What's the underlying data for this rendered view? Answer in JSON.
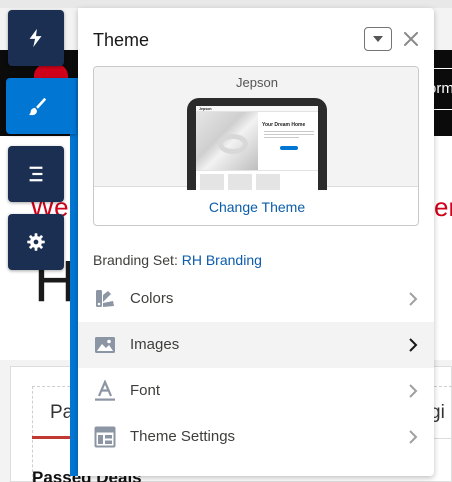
{
  "background": {
    "band_text": "orm",
    "red_left": "We",
    "red_right": "er",
    "big_letter": "H",
    "tab_left": "Pa",
    "tab_right": "gi",
    "bottom_heading": "Passed Deals"
  },
  "rail": {
    "items": [
      {
        "icon": "lightning-icon"
      },
      {
        "icon": "brush-icon",
        "active": true
      },
      {
        "icon": "list-icon"
      },
      {
        "icon": "gear-icon"
      }
    ]
  },
  "panel": {
    "title": "Theme",
    "theme_name": "Jepson",
    "preview": {
      "logo": "Jepson",
      "headline": "Your Dream Home"
    },
    "change_theme_label": "Change Theme",
    "branding_label": "Branding Set:",
    "branding_value": "RH Branding",
    "menu": [
      {
        "label": "Colors",
        "icon": "colors-icon"
      },
      {
        "label": "Images",
        "icon": "image-icon",
        "selected": true
      },
      {
        "label": "Font",
        "icon": "font-icon"
      },
      {
        "label": "Theme Settings",
        "icon": "layout-icon"
      }
    ]
  },
  "colors": {
    "accent": "#0176d3",
    "rail": "#1b2f52",
    "link": "#0b5cab",
    "highlight_red": "#d0021b"
  }
}
